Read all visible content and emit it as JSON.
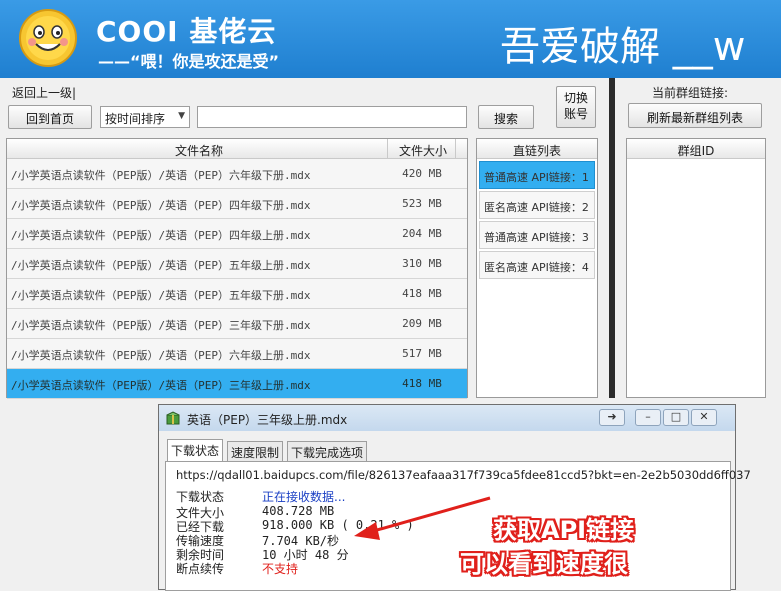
{
  "header": {
    "brand": "COOI 基佬云",
    "slogan": "——“喂！你是攻还是受”",
    "watermark": "吾爱破解 __w"
  },
  "nav": {
    "back_label": "返回上一级|",
    "home_label": "回到首页",
    "sort_value": "按时间排序",
    "search_value": "",
    "search_label": "搜索",
    "switch_label": "切换账号"
  },
  "files": {
    "columns": [
      "文件名称",
      "文件大小"
    ],
    "rows": [
      {
        "name": "/小学英语点读软件（PEP版）/英语（PEP）六年级下册.mdx",
        "size": "420 MB"
      },
      {
        "name": "/小学英语点读软件（PEP版）/英语（PEP）四年级下册.mdx",
        "size": "523 MB"
      },
      {
        "name": "/小学英语点读软件（PEP版）/英语（PEP）四年级上册.mdx",
        "size": "204 MB"
      },
      {
        "name": "/小学英语点读软件（PEP版）/英语（PEP）五年级上册.mdx",
        "size": "310 MB"
      },
      {
        "name": "/小学英语点读软件（PEP版）/英语（PEP）五年级下册.mdx",
        "size": "418 MB"
      },
      {
        "name": "/小学英语点读软件（PEP版）/英语（PEP）三年级下册.mdx",
        "size": "209 MB"
      },
      {
        "name": "/小学英语点读软件（PEP版）/英语（PEP）六年级上册.mdx",
        "size": "517 MB"
      },
      {
        "name": "/小学英语点读软件（PEP版）/英语（PEP）三年级上册.mdx",
        "size": "418 MB"
      }
    ]
  },
  "links": {
    "header": "直链列表",
    "items": [
      "普通高速 API链接：1",
      "匿名高速 API链接：2",
      "普通高速 API链接：3",
      "匿名高速 API链接：4"
    ]
  },
  "group": {
    "current_label": "当前群组链接:",
    "refresh_label": "刷新最新群组列表",
    "header": "群组ID"
  },
  "dialog": {
    "title": "英语（PEP）三年级上册.mdx",
    "tabs": [
      "下载状态",
      "速度限制",
      "下载完成选项"
    ],
    "url": "https://qdall01.baidupcs.com/file/826137eafaaa317f739ca5fdee81ccd5?bkt=en-2e2b5030dd6ff037",
    "status_label": "下载状态",
    "status_value": "正在接收数据...",
    "fields": [
      {
        "label": "文件大小",
        "value": "408.728  MB"
      },
      {
        "label": "已经下载",
        "value": "918.000  KB  ( 0.21 % )"
      },
      {
        "label": "传输速度",
        "value": "7.704  KB/秒"
      },
      {
        "label": "剩余时间",
        "value": "10 小时 48 分"
      }
    ],
    "resume_label": "断点续传",
    "resume_value": "不支持"
  },
  "annotation": {
    "line1": "获取API链接",
    "line2": "可以看到速度很"
  },
  "colors": {
    "banner": "#2a8ddc",
    "selected": "#33aef0",
    "status_blue": "#1a3fc4",
    "unsupported_red": "#e0201b",
    "annotation_red": "#e0201b"
  }
}
